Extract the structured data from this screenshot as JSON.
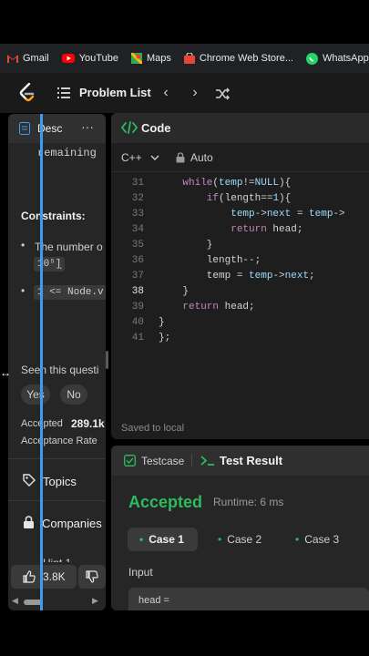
{
  "bookmarks": [
    {
      "label": "Gmail",
      "icon": "gmail-icon",
      "color": "#ea4335"
    },
    {
      "label": "YouTube",
      "icon": "youtube-icon",
      "color": "#ff0000"
    },
    {
      "label": "Maps",
      "icon": "maps-icon",
      "color": "#34a853"
    },
    {
      "label": "Chrome Web Store...",
      "icon": "chrome-web-store-icon",
      "color": "#e8453c"
    },
    {
      "label": "WhatsApp",
      "icon": "whatsapp-icon",
      "color": "#25d366"
    }
  ],
  "header": {
    "problem_list": "Problem List"
  },
  "description": {
    "tab_label": "Desc",
    "more": "···",
    "remaining_text": "remaining",
    "constraints_title": "Constraints:",
    "constraint_1": "The number o",
    "constraint_1_code": "10⁵]",
    "constraint_1_suffix": ".",
    "constraint_2_code": "1 <= Node.v",
    "seen_question": "Seen this questi",
    "yes": "Yes",
    "no": "No",
    "accepted_label": "Accepted",
    "accepted_value": "289.1k",
    "acceptance_rate": "Acceptance Rate",
    "topics": "Topics",
    "companies": "Companies",
    "hint": "Hint 1",
    "likes": "3.8K"
  },
  "code": {
    "title": "Code",
    "language": "C++",
    "mode": "Auto",
    "saved": "Saved to local",
    "lines": [
      {
        "n": "31",
        "text": "        while(temp!=NULL){"
      },
      {
        "n": "32",
        "text": "            if(length==1){"
      },
      {
        "n": "33",
        "text": "                temp->next = temp->"
      },
      {
        "n": "34",
        "text": "                return head;"
      },
      {
        "n": "35",
        "text": "            }"
      },
      {
        "n": "36",
        "text": "            length--;"
      },
      {
        "n": "37",
        "text": "            temp = temp->next;"
      },
      {
        "n": "38",
        "text": "        }"
      },
      {
        "n": "39",
        "text": "        return head;"
      },
      {
        "n": "40",
        "text": "    }"
      },
      {
        "n": "41",
        "text": "};"
      }
    ]
  },
  "test": {
    "tab_testcase": "Testcase",
    "tab_result": "Test Result",
    "status": "Accepted",
    "runtime": "Runtime: 6 ms",
    "cases": [
      "Case 1",
      "Case 2",
      "Case 3"
    ],
    "input_label": "Input",
    "input_value": "head ="
  },
  "colors": {
    "accent_green": "#2cbb5d",
    "blue_cursor_line": "#3d9bf0",
    "panel_bg": "#262626"
  }
}
